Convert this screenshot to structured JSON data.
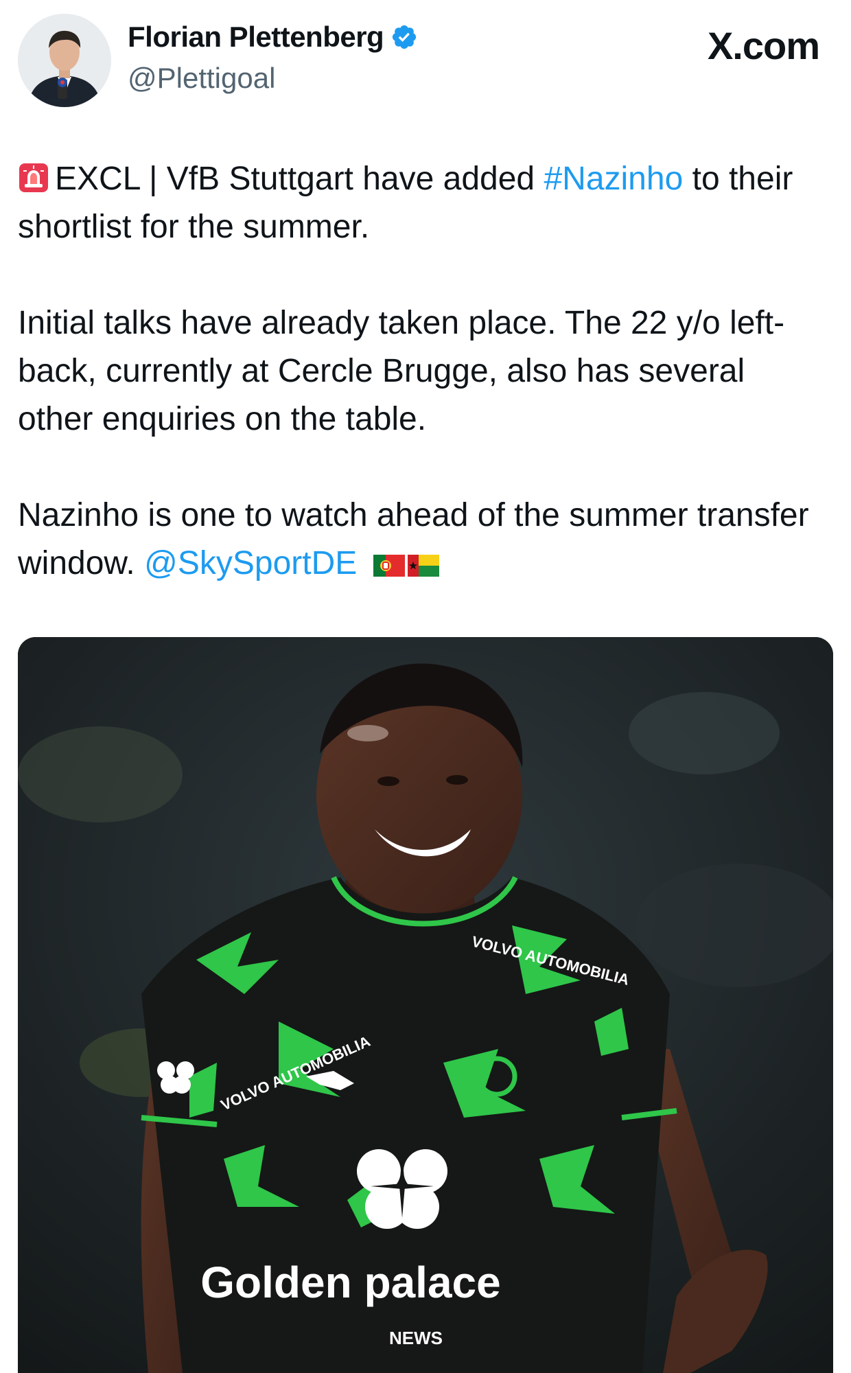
{
  "author": {
    "name": "Florian Plettenberg",
    "handle": "@Plettigoal",
    "verified": true,
    "avatar_icon": "person-avatar-icon"
  },
  "site": {
    "label": "X.com"
  },
  "tweet": {
    "line1_prefix": "EXCL | VfB Stuttgart have added ",
    "hashtag": "#Nazinho",
    "line1_suffix": " to their shortlist for the summer.",
    "para2": "Initial talks have already taken place. The 22 y/o left-back, currently at Cercle Brugge, also has several other enquiries on the table.",
    "para3_prefix": "Nazinho is one to watch ahead of the summer transfer window. ",
    "mention": "@SkySportDE",
    "emojis": [
      "siren-emoji",
      "portugal-flag",
      "guinea-bissau-flag"
    ]
  },
  "media": {
    "kind": "photo",
    "icon": "football-player-photo",
    "shirt_sponsor": "Golden Palace",
    "shirt_text": [
      "VOLVO AUTOMOBILIA",
      "Golden palace",
      "NEWS"
    ],
    "colors": {
      "shirt_black": "#151816",
      "shirt_green": "#2fc64a",
      "background": "#1c2226"
    }
  },
  "colors": {
    "link": "#1d9bf0",
    "text": "#0f1419",
    "secondary": "#536471",
    "verified": "#1d9bf0"
  }
}
